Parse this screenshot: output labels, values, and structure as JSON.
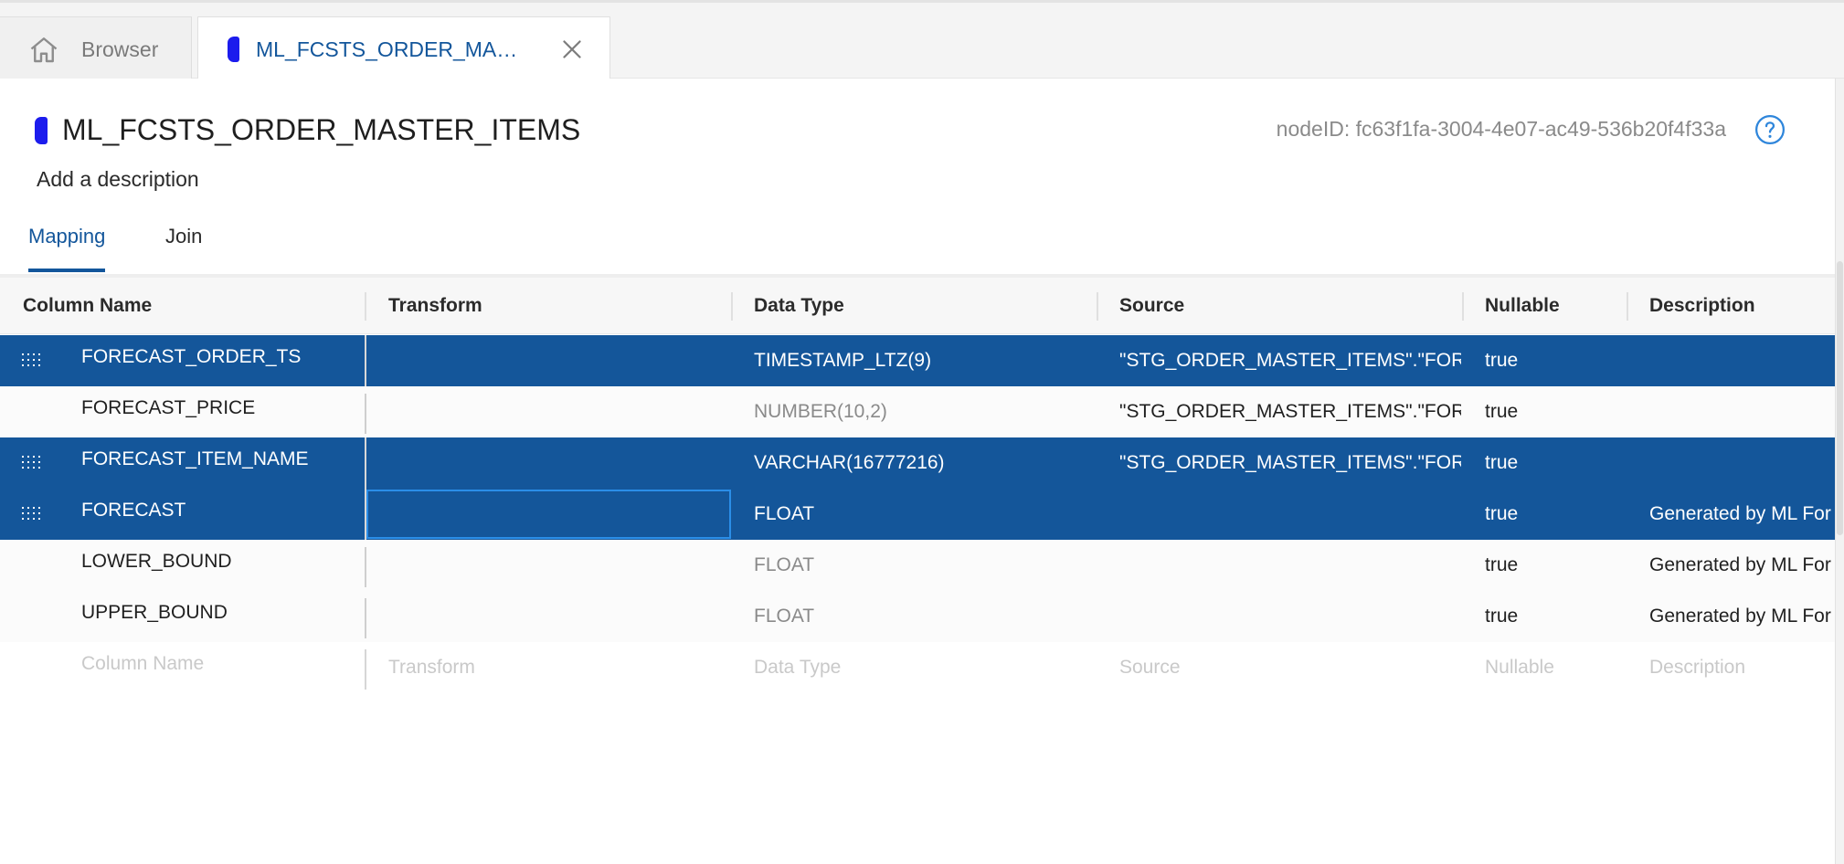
{
  "tabs": {
    "browser_label": "Browser",
    "active_label": "ML_FCSTS_ORDER_MAST...",
    "home_icon": "home-icon",
    "close_icon": "close-icon"
  },
  "node": {
    "title": "ML_FCSTS_ORDER_MASTER_ITEMS",
    "description_placeholder": "Add a description",
    "node_id": "nodeID: fc63f1fa-3004-4e07-ac49-536b20f4f33a",
    "help_icon": "help-icon",
    "node_color": "#1c1ced"
  },
  "subtabs": {
    "mapping": "Mapping",
    "join": "Join"
  },
  "grid": {
    "headers": {
      "column_name": "Column Name",
      "transform": "Transform",
      "data_type": "Data Type",
      "source": "Source",
      "nullable": "Nullable",
      "description": "Description"
    },
    "rows": [
      {
        "name": "FORECAST_ORDER_TS",
        "transform": "",
        "type": "TIMESTAMP_LTZ(9)",
        "source": "\"STG_ORDER_MASTER_ITEMS\".\"FORE(",
        "nullable": "true",
        "description": ""
      },
      {
        "name": "FORECAST_PRICE",
        "transform": "",
        "type": "NUMBER(10,2)",
        "source": "\"STG_ORDER_MASTER_ITEMS\".\"FORE(",
        "nullable": "true",
        "description": ""
      },
      {
        "name": "FORECAST_ITEM_NAME",
        "transform": "",
        "type": "VARCHAR(16777216)",
        "source": "\"STG_ORDER_MASTER_ITEMS\".\"FORE(",
        "nullable": "true",
        "description": ""
      },
      {
        "name": "FORECAST",
        "transform": "",
        "type": "FLOAT",
        "source": "",
        "nullable": "true",
        "description": "Generated by ML For"
      },
      {
        "name": "LOWER_BOUND",
        "transform": "",
        "type": "FLOAT",
        "source": "",
        "nullable": "true",
        "description": "Generated by ML For"
      },
      {
        "name": "UPPER_BOUND",
        "transform": "",
        "type": "FLOAT",
        "source": "",
        "nullable": "true",
        "description": "Generated by ML For"
      }
    ],
    "new_row_placeholders": {
      "name": "Column Name",
      "transform": "Transform",
      "type": "Data Type",
      "source": "Source",
      "nullable": "Nullable",
      "description": "Description"
    },
    "selected_color": "#14569a",
    "drag_handle_icon": "drag-handle-icon"
  }
}
